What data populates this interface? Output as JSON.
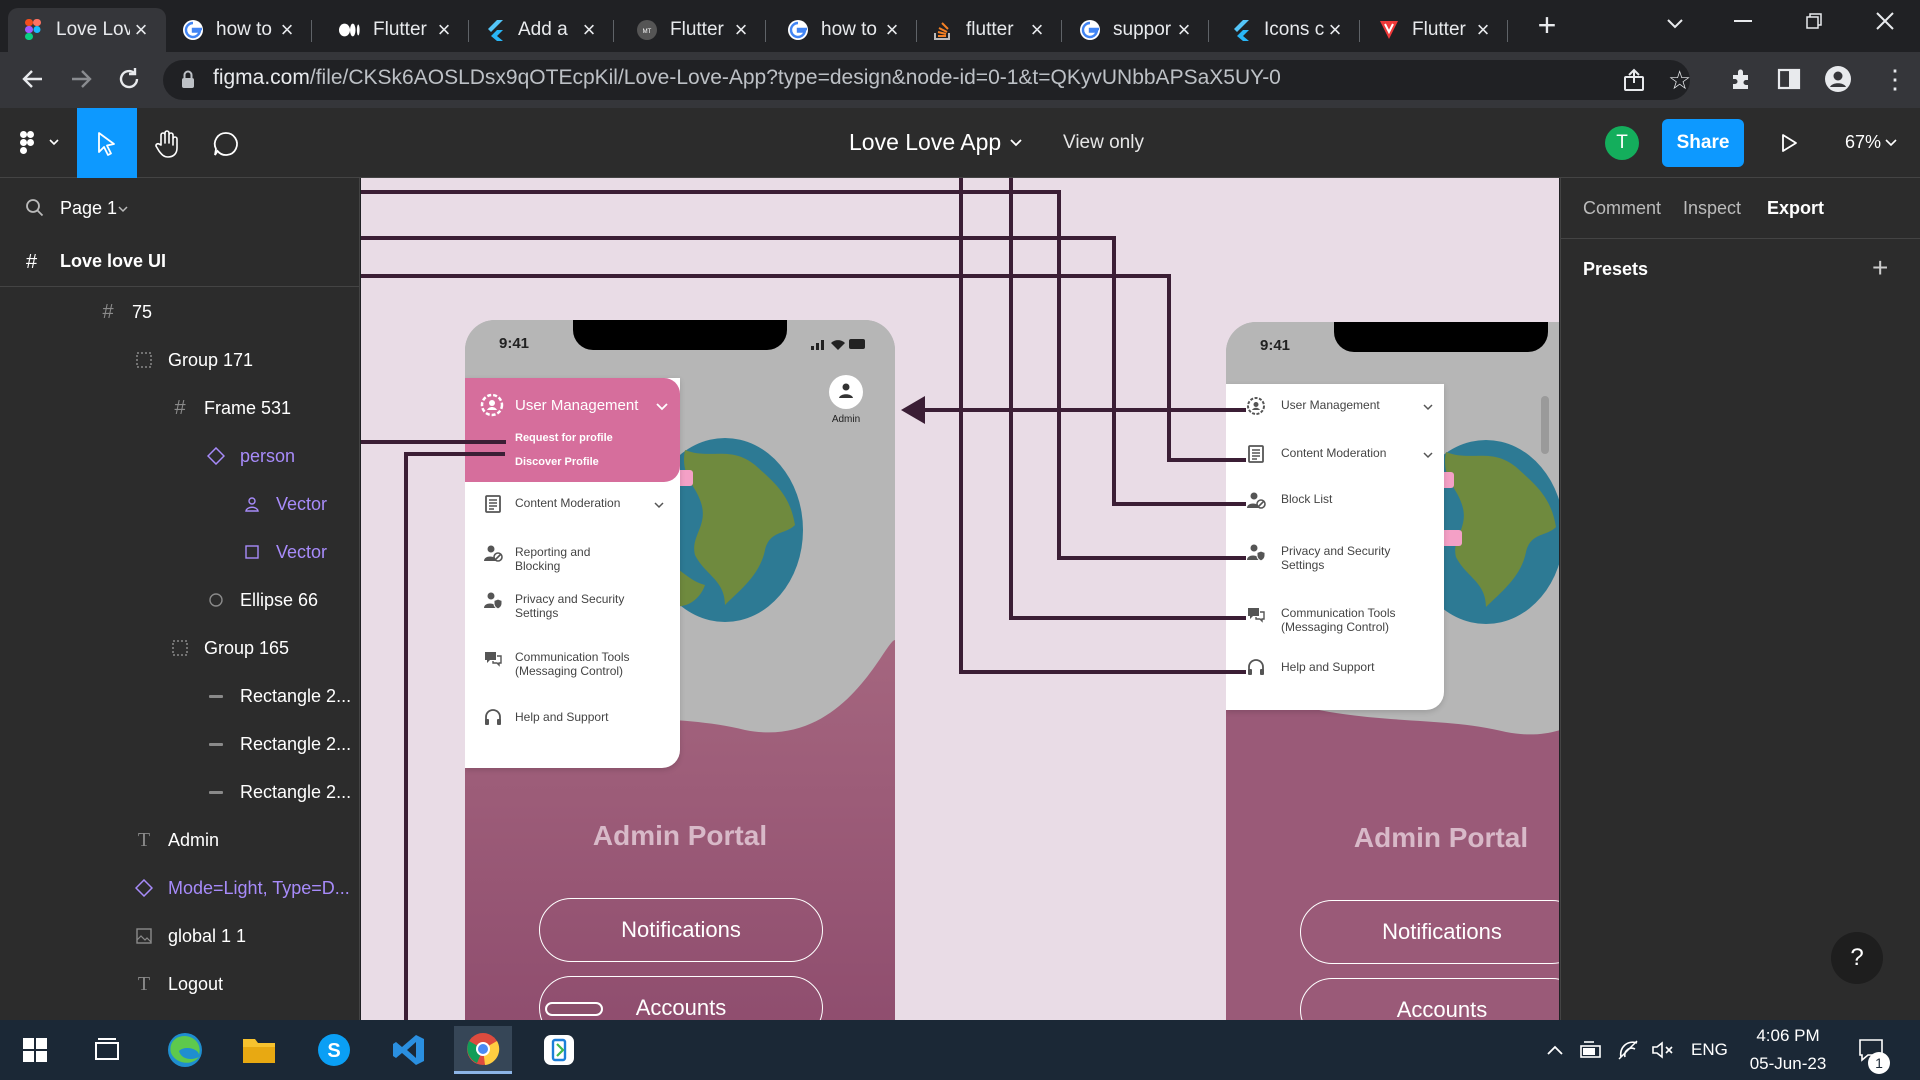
{
  "browser": {
    "tabs": [
      {
        "title": "Love Love App",
        "icon": "figma-icon",
        "active": true
      },
      {
        "title": "how to",
        "icon": "google-icon"
      },
      {
        "title": "Flutter",
        "icon": "medium-icon"
      },
      {
        "title": "Add a",
        "icon": "flutter-icon"
      },
      {
        "title": "Flutter",
        "icon": "mighty-techno-icon"
      },
      {
        "title": "how to",
        "icon": "google-icon"
      },
      {
        "title": "flutter",
        "icon": "stackoverflow-icon"
      },
      {
        "title": "suppor",
        "icon": "google-icon"
      },
      {
        "title": "Icons c",
        "icon": "flutter-icon"
      },
      {
        "title": "Flutter",
        "icon": "vivaldi-icon"
      }
    ],
    "url_domain": "figma.com",
    "url_path": "/file/CKSk6AOSLDsx9qOTEcpKil/Love-Love-App?type=design&node-id=0-1&t=QKyvUNbbAPSaX5UY-0"
  },
  "figma": {
    "file_title": "Love Love App",
    "view_mode": "View only",
    "avatar_initial": "T",
    "share_label": "Share",
    "zoom": "67%",
    "page": "Page 1",
    "frame_title": "Love love UI",
    "layers": [
      {
        "name": "75",
        "icon": "frame-icon",
        "indent": 1
      },
      {
        "name": "Group 171",
        "icon": "group-icon",
        "indent": 2
      },
      {
        "name": "Frame 531",
        "icon": "frame-icon",
        "indent": 3
      },
      {
        "name": "person",
        "icon": "component-icon",
        "indent": 4,
        "purple": true
      },
      {
        "name": "Vector",
        "icon": "person-icon",
        "indent": 5,
        "purple": true
      },
      {
        "name": "Vector",
        "icon": "square-icon",
        "indent": 5,
        "purple": true
      },
      {
        "name": "Ellipse 66",
        "icon": "ellipse-icon",
        "indent": 4
      },
      {
        "name": "Group 165",
        "icon": "group-icon",
        "indent": 3
      },
      {
        "name": "Rectangle 2...",
        "icon": "rect-line-icon",
        "indent": 4
      },
      {
        "name": "Rectangle 2...",
        "icon": "rect-line-icon",
        "indent": 4
      },
      {
        "name": "Rectangle 2...",
        "icon": "rect-line-icon",
        "indent": 4
      },
      {
        "name": "Admin",
        "icon": "text-icon",
        "indent": 2
      },
      {
        "name": "Mode=Light, Type=D...",
        "icon": "component-icon",
        "indent": 2,
        "purple": true
      },
      {
        "name": "global 1 1",
        "icon": "image-icon",
        "indent": 2
      },
      {
        "name": "Logout",
        "icon": "text-icon",
        "indent": 2
      }
    ],
    "right_tabs": [
      "Comment",
      "Inspect",
      "Export"
    ],
    "presets_label": "Presets"
  },
  "phone_left": {
    "time": "9:41",
    "admin_label": "Admin",
    "menu_header": "User Management",
    "submenu": [
      "Request for profile",
      "Discover Profile"
    ],
    "items": [
      {
        "label": "Content Moderation",
        "icon": "document-icon",
        "chevron": true
      },
      {
        "label": "Reporting and Blocking",
        "icon": "user-block-icon"
      },
      {
        "label": "Privacy and Security Settings",
        "icon": "shield-user-icon"
      },
      {
        "label": "Communication Tools (Messaging Control)",
        "icon": "chat-icon"
      },
      {
        "label": "Help and Support",
        "icon": "headset-icon"
      }
    ],
    "portal_title": "Admin Portal",
    "buttons": [
      "Notifications",
      "Accounts"
    ]
  },
  "phone_right": {
    "time": "9:41",
    "items": [
      {
        "label": "User Management",
        "icon": "gear-user-icon",
        "chevron": true
      },
      {
        "label": "Content Moderation",
        "icon": "document-icon",
        "chevron": true
      },
      {
        "label": "Block List",
        "icon": "user-block-icon"
      },
      {
        "label": "Privacy and Security Settings",
        "icon": "shield-user-icon"
      },
      {
        "label": "Communication Tools (Messaging Control)",
        "icon": "chat-icon"
      },
      {
        "label": "Help and Support",
        "icon": "headset-icon"
      }
    ],
    "portal_title": "Admin Portal",
    "buttons": [
      "Notifications",
      "Accounts"
    ]
  },
  "taskbar": {
    "language": "ENG",
    "time": "4:06 PM",
    "date": "05-Jun-23",
    "notification_count": "1"
  },
  "colors": {
    "accent_blue": "#0d99ff",
    "figma_dark": "#2c2c2c",
    "canvas_bg": "#e9dce6",
    "menu_pink": "#d76b9c",
    "portal_mauve": "#a0607f",
    "prototype_line": "#3b1e35",
    "avatar_green": "#14ae5c"
  }
}
